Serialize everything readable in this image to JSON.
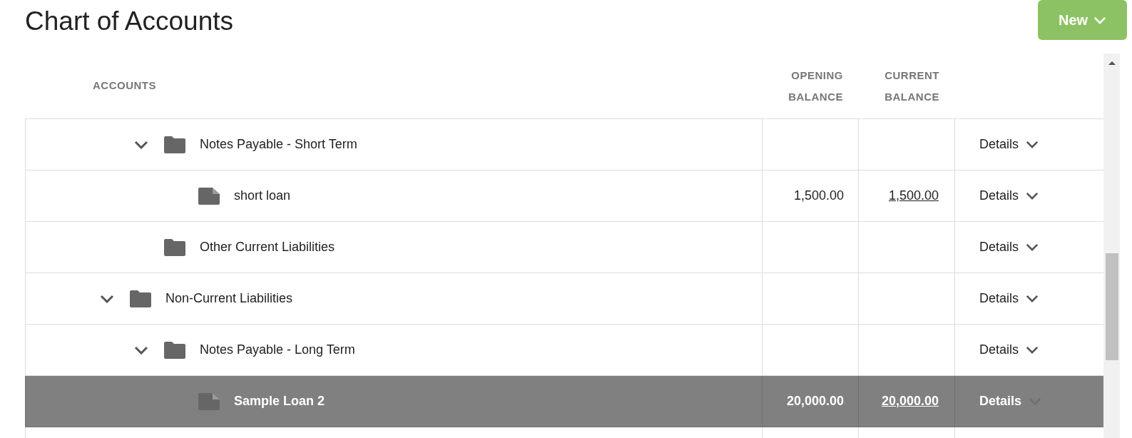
{
  "page": {
    "title": "Chart of Accounts",
    "new_button": "New"
  },
  "table": {
    "columns": [
      "ACCOUNTS",
      "OPENING BALANCE",
      "CURRENT BALANCE"
    ],
    "rows": [
      {
        "children": [
          {
            "label": "Notes Payable - Short Term",
            "kind": "folder",
            "expanded": true,
            "selected": false,
            "action": "Details",
            "children": [
              {
                "label": "short loan",
                "kind": "account",
                "selected": false,
                "opening_balance": "1,500.00",
                "current_balance": "1,500.00",
                "action": "Details"
              }
            ]
          },
          {
            "label": "Other Current Liabilities",
            "kind": "folder",
            "selected": false,
            "action": "Details"
          }
        ]
      },
      {
        "label": "Non-Current Liabilities",
        "kind": "folder",
        "expanded": true,
        "selected": false,
        "action": "Details",
        "children": [
          {
            "label": "Notes Payable - Long Term",
            "kind": "folder",
            "expanded": true,
            "selected": false,
            "action": "Details",
            "children": [
              {
                "label": "Sample Loan 2",
                "kind": "account",
                "selected": true,
                "opening_balance": "20,000.00",
                "current_balance": "20,000.00",
                "action": "Details"
              }
            ]
          }
        ]
      }
    ]
  }
}
